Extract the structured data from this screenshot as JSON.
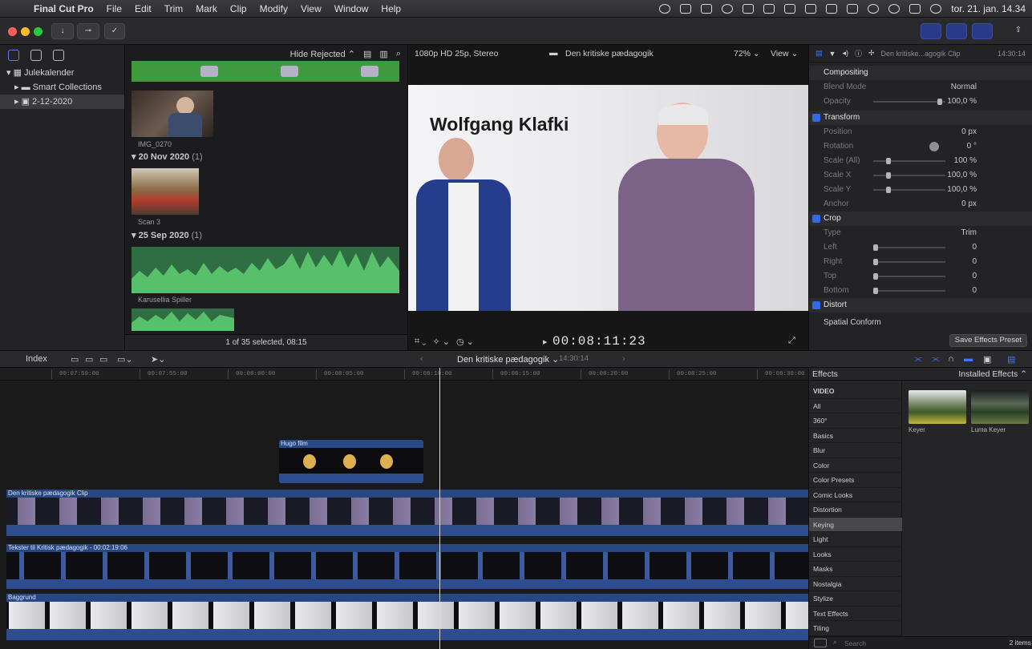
{
  "menubar": {
    "items": [
      "Final Cut Pro",
      "File",
      "Edit",
      "Trim",
      "Mark",
      "Clip",
      "Modify",
      "View",
      "Window",
      "Help"
    ],
    "clock": "tor. 21. jan.  14.34"
  },
  "library": {
    "items": [
      {
        "label": "Julekalender"
      },
      {
        "label": "Smart Collections"
      },
      {
        "label": "2-12-2020"
      }
    ]
  },
  "browser": {
    "filter": "Hide Rejected",
    "groups": [
      {
        "date": "20 Nov 2020",
        "count": "(1)"
      },
      {
        "date": "25 Sep 2020",
        "count": "(1)"
      }
    ],
    "clips": [
      "IMG_0270",
      "Scan 3",
      "Karusellia Spiller"
    ],
    "status": "1 of 35 selected, 08:15"
  },
  "viewer": {
    "format": "1080p HD 25p, Stereo",
    "project": "Den kritiske pædagogik",
    "zoom": "72%",
    "view": "View",
    "overlay_title": "Wolfgang Klafki",
    "timecode": "00:08:11:23"
  },
  "inspector": {
    "clip": "Den kritiske...agogik Clip",
    "duration": "14:30:14",
    "rows": [
      {
        "label": "Compositing",
        "value": "",
        "section": true
      },
      {
        "label": "Blend Mode",
        "value": "Normal"
      },
      {
        "label": "Opacity",
        "value": "100,0 %"
      },
      {
        "label": "Transform",
        "value": "",
        "section": true
      },
      {
        "label": "Position",
        "value": "0 px"
      },
      {
        "label": "Rotation",
        "value": "0 °"
      },
      {
        "label": "Scale (All)",
        "value": "100 %"
      },
      {
        "label": "Scale X",
        "value": "100,0 %"
      },
      {
        "label": "Scale Y",
        "value": "100,0 %"
      },
      {
        "label": "Anchor",
        "value": "0 px"
      },
      {
        "label": "Crop",
        "value": "",
        "section": true
      },
      {
        "label": "Type",
        "value": "Trim"
      },
      {
        "label": "Left",
        "value": "0"
      },
      {
        "label": "Right",
        "value": "0"
      },
      {
        "label": "Top",
        "value": "0"
      },
      {
        "label": "Bottom",
        "value": "0"
      },
      {
        "label": "Distort",
        "value": "",
        "section": true
      },
      {
        "label": "Spatial Conform",
        "value": ""
      }
    ],
    "save_preset": "Save Effects Preset"
  },
  "timeline": {
    "index_tab": "Index",
    "project": "Den kritiske pædagogik",
    "project_duration": "14:30:14",
    "ruler": [
      "00:07:50:00",
      "00:07:55:00",
      "00:08:00:00",
      "00:08:05:00",
      "00:08:10:00",
      "00:08:15:00",
      "00:08:20:00",
      "00:08:25:00",
      "00:08:30:00"
    ],
    "clips": {
      "hugo": "Hugo film",
      "main": "Den kritiske pædagogik Clip",
      "text": "Tekster til Kritisk pædagogik - 00:02:19:06",
      "bg": "Baggrund"
    }
  },
  "effects": {
    "title": "Effects",
    "installed": "Installed Effects",
    "categories": [
      "VIDEO",
      "All",
      "360°",
      "Basics",
      "Blur",
      "Color",
      "Color Presets",
      "Comic Looks",
      "Distortion",
      "Keying",
      "Light",
      "Looks",
      "Masks",
      "Nostalgia",
      "Stylize",
      "Text Effects",
      "Tiling"
    ],
    "selected": "Keying",
    "results": [
      "Keyer",
      "Luma Keyer"
    ],
    "search_placeholder": "Search",
    "count": "2 items"
  }
}
